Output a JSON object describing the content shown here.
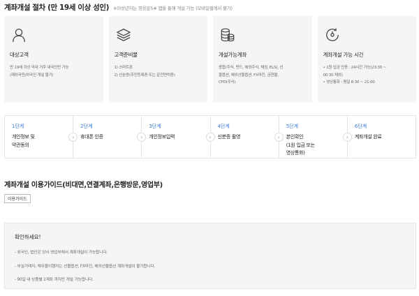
{
  "header": {
    "title": "계좌개설 절차 (만 19세 이상 성인)",
    "note": "※미성년자는 영웅문S# 앱을 통해 개설 가능 (모바일웹에서 불가)"
  },
  "cards": [
    {
      "icon": "person-icon",
      "title": "대상고객",
      "lines": [
        "만 19세 이상 국내 거주 내국인만 가능",
        "(재외국민/외국인 개설 불가)"
      ]
    },
    {
      "icon": "layers-icon",
      "title": "고객준비물",
      "lines": [
        "1) 스마트폰",
        "2) 신분증(주민등록증 또는 운전면허증)"
      ]
    },
    {
      "icon": "coins-icon",
      "title": "개설가능계좌",
      "lines": [
        "종합(주식, 펀드, 해외주식, 채권, ELS), 선",
        "물옵션, 해외선물옵션, FX마진, 금현물,",
        "CFD(주식)"
      ]
    },
    {
      "icon": "clock-icon",
      "title": "계좌개설 가능 시간",
      "lines": [
        "• 1원 입금 인증 : 24시간 가능(23:30 ~",
        "  00:30 제외)",
        "• 영상통화 : 평일 8:30 ~ 21:00"
      ]
    }
  ],
  "steps": [
    {
      "no": "1단계",
      "lines": [
        "개인정보 및",
        "약관동의"
      ]
    },
    {
      "no": "2단계",
      "lines": [
        "휴대폰 인증"
      ]
    },
    {
      "no": "3단계",
      "lines": [
        "개인정보입력"
      ]
    },
    {
      "no": "4단계",
      "lines": [
        "신분증 촬영"
      ]
    },
    {
      "no": "5단계",
      "lines": [
        "본인확인",
        "(1원 입금 또는",
        "영상통화)"
      ]
    },
    {
      "no": "6단계",
      "lines": [
        "계좌개설 완료"
      ]
    }
  ],
  "guide": {
    "title": "계좌개설 이용가이드(비대면,연결계좌,은행방문,영업부)",
    "button_label": "이용가이드"
  },
  "notice": {
    "title": "확인하세요!",
    "lines": [
      "- 외국인, 법인은 당사 영업부에서 계좌개설이 가능합니다.",
      "- 부실거래자, 채무불이행자는 선물옵션, FX마진, 해외선물옵션 계좌개설이 불가합니다.",
      "- 90일 내 상품별 2계좌 까지만 개설 가능합니다."
    ]
  },
  "colors": {
    "accent": "#3a78d8",
    "card_bg": "#f4f5f7"
  }
}
